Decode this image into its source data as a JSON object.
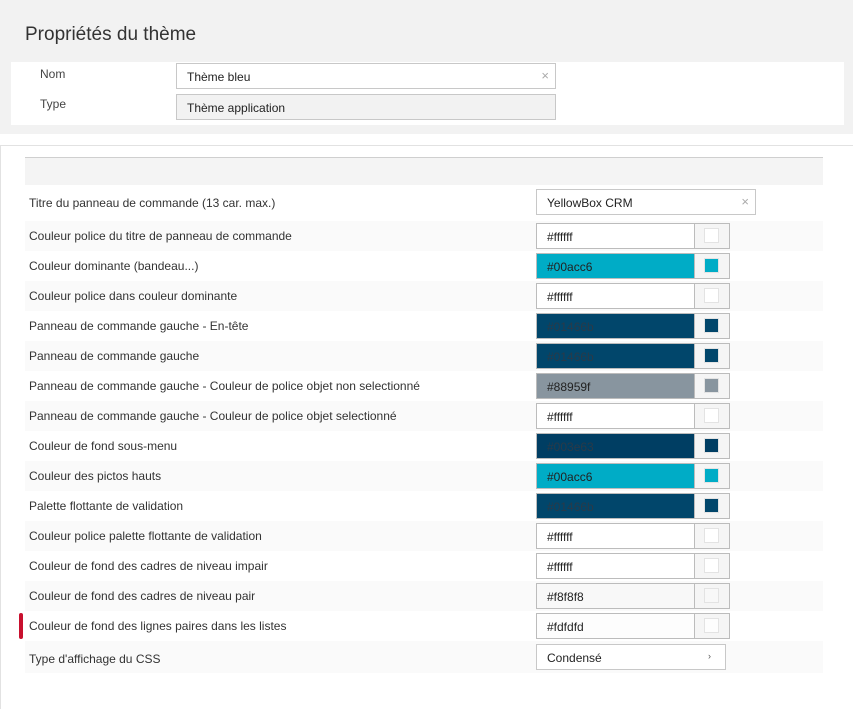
{
  "page": {
    "title": "Propriétés du thème"
  },
  "header_form": {
    "name_label": "Nom",
    "name_value": "Thème bleu",
    "type_label": "Type",
    "type_value": "Thème application",
    "clear_glyph": "×"
  },
  "rows": {
    "panel_title": {
      "label": "Titre du panneau de commande (13 car. max.)",
      "value": "YellowBox CRM"
    },
    "r1": {
      "label": "Couleur police du titre de panneau de commande",
      "value": "#ffffff",
      "color": "#ffffff"
    },
    "r2": {
      "label": "Couleur dominante (bandeau...)",
      "value": "#00acc6",
      "color": "#00acc6"
    },
    "r3": {
      "label": "Couleur police dans couleur dominante",
      "value": "#ffffff",
      "color": "#ffffff"
    },
    "r4": {
      "label": "Panneau de commande gauche - En-tête",
      "value": "#01466b",
      "color": "#01466b"
    },
    "r5": {
      "label": "Panneau de commande gauche",
      "value": "#01466b",
      "color": "#01466b"
    },
    "r6": {
      "label": "Panneau de commande gauche - Couleur de police objet non selectionné",
      "value": "#88959f",
      "color": "#88959f"
    },
    "r7": {
      "label": "Panneau de commande gauche - Couleur de police objet selectionné",
      "value": "#ffffff",
      "color": "#ffffff"
    },
    "r8": {
      "label": "Couleur de fond sous-menu",
      "value": "#003e63",
      "color": "#003e63"
    },
    "r9": {
      "label": "Couleur des pictos hauts",
      "value": "#00acc6",
      "color": "#00acc6"
    },
    "r10": {
      "label": "Palette flottante de validation",
      "value": "#01466b",
      "color": "#01466b"
    },
    "r11": {
      "label": "Couleur police palette flottante de validation",
      "value": "#ffffff",
      "color": "#ffffff"
    },
    "r12": {
      "label": "Couleur de fond des cadres de niveau impair",
      "value": "#ffffff",
      "color": "#ffffff"
    },
    "r13": {
      "label": "Couleur de fond des cadres de niveau pair",
      "value": "#f8f8f8",
      "color": "#f8f8f8"
    },
    "r14": {
      "label": "Couleur de fond des lignes paires dans les listes",
      "value": "#fdfdfd",
      "color": "#fdfdfd"
    },
    "css_display": {
      "label": "Type d'affichage du CSS",
      "value": "Condensé",
      "caret": "›"
    }
  },
  "accent_marker_color": "#c8102e"
}
